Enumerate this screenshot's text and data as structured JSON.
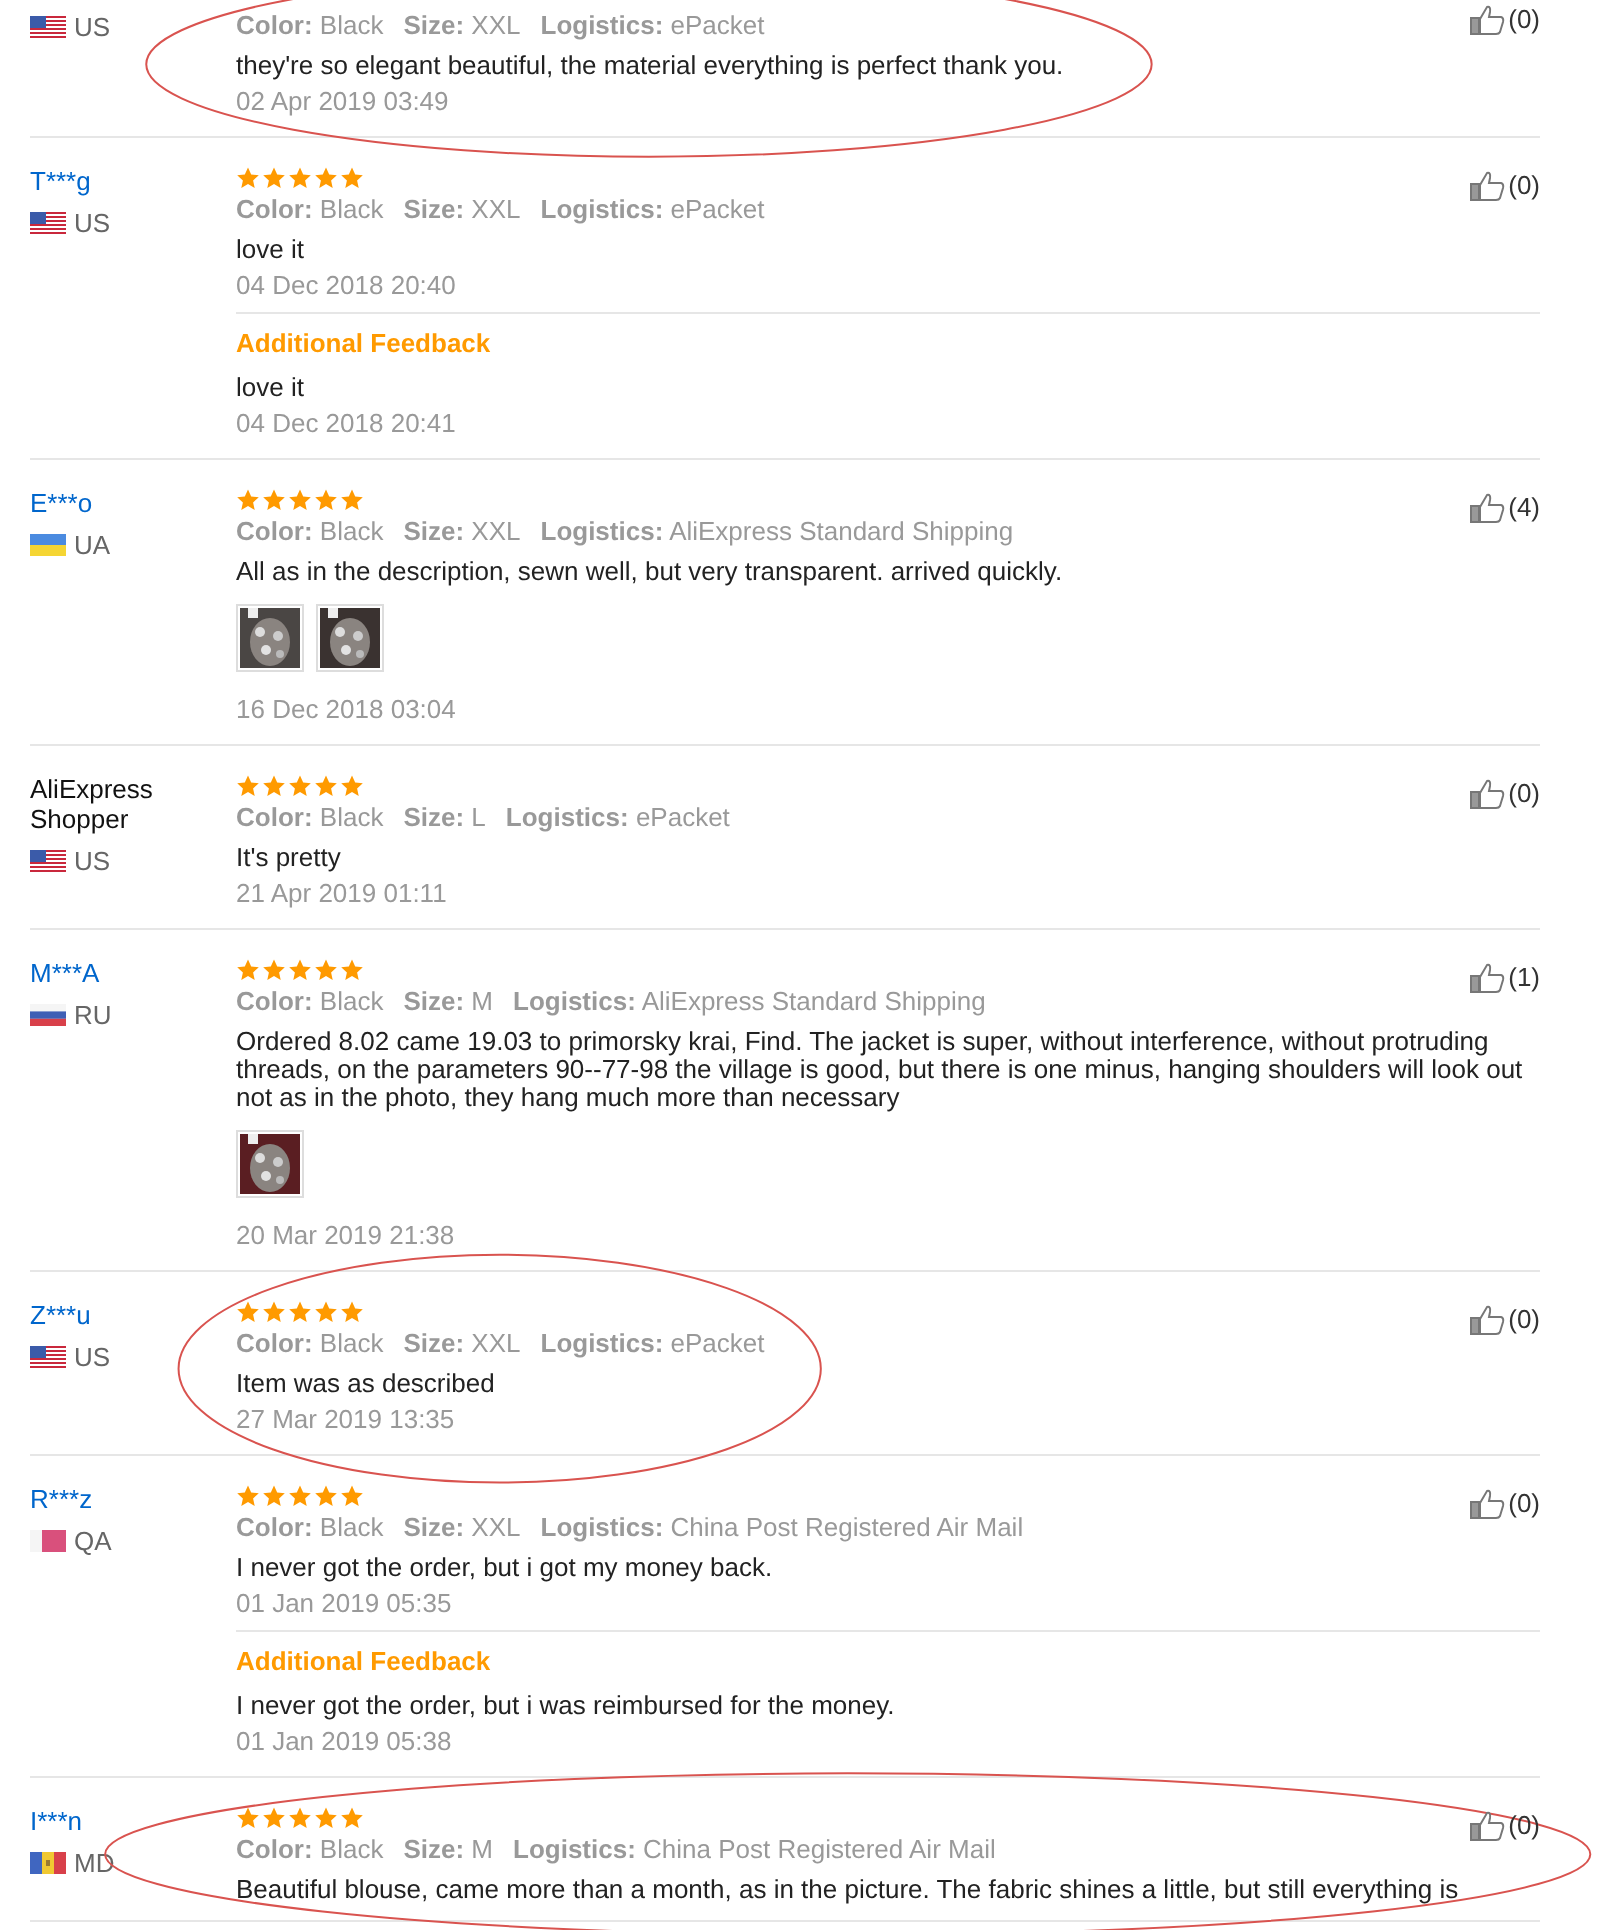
{
  "reviews": [
    {
      "country": {
        "code": "US",
        "kind": "us"
      },
      "attributes": [
        {
          "label": "Color:",
          "value": "Black"
        },
        {
          "label": "Size:",
          "value": "XXL"
        },
        {
          "label": "Logistics:",
          "value": "ePacket"
        }
      ],
      "text": "they're so elegant beautiful, the material everything is perfect thank you.",
      "date": "02 Apr 2019 03:49",
      "likes": "(0)",
      "circled": true
    },
    {
      "name": "T***g",
      "linked": true,
      "country": {
        "code": "US",
        "kind": "us"
      },
      "stars": 5,
      "attributes": [
        {
          "label": "Color:",
          "value": "Black"
        },
        {
          "label": "Size:",
          "value": "XXL"
        },
        {
          "label": "Logistics:",
          "value": "ePacket"
        }
      ],
      "text": "love it",
      "date": "04 Dec 2018 20:40",
      "likes": "(0)",
      "circled": false,
      "additional": {
        "title": "Additional Feedback",
        "text": "love it",
        "date": "04 Dec 2018 20:41"
      }
    },
    {
      "name": "E***o",
      "linked": true,
      "country": {
        "code": "UA",
        "kind": "ua"
      },
      "stars": 5,
      "attributes": [
        {
          "label": "Color:",
          "value": "Black"
        },
        {
          "label": "Size:",
          "value": "XXL"
        },
        {
          "label": "Logistics:",
          "value": "AliExpress Standard Shipping"
        }
      ],
      "text": "All as in the description, sewn well, but very transparent. arrived quickly.",
      "photos": [
        {
          "kind": "picture"
        },
        {
          "kind": "picture"
        }
      ],
      "date": "16 Dec 2018 03:04",
      "likes": "(4)",
      "circled": false
    },
    {
      "name": "AliExpress Shopper",
      "linked": false,
      "country": {
        "code": "US",
        "kind": "us"
      },
      "stars": 5,
      "attributes": [
        {
          "label": "Color:",
          "value": "Black"
        },
        {
          "label": "Size:",
          "value": "L"
        },
        {
          "label": "Logistics:",
          "value": "ePacket"
        }
      ],
      "text": "It's pretty",
      "date": "21 Apr 2019 01:11",
      "likes": "(0)",
      "circled": false
    },
    {
      "name": "M***A",
      "linked": true,
      "country": {
        "code": "RU",
        "kind": "ru"
      },
      "stars": 5,
      "attributes": [
        {
          "label": "Color:",
          "value": "Black"
        },
        {
          "label": "Size:",
          "value": "M"
        },
        {
          "label": "Logistics:",
          "value": "AliExpress Standard Shipping"
        }
      ],
      "text": "Ordered 8.02 came 19.03 to primorsky krai, Find. The jacket is super, without interference, without protruding threads, on the parameters 90--77-98 the village is good, but there is one minus, hanging shoulders will look out not as in the photo, they hang much more than necessary",
      "photos": [
        {
          "kind": "picture"
        }
      ],
      "date": "20 Mar 2019 21:38",
      "likes": "(1)",
      "circled": false
    },
    {
      "name": "Z***u",
      "linked": true,
      "country": {
        "code": "US",
        "kind": "us"
      },
      "stars": 5,
      "attributes": [
        {
          "label": "Color:",
          "value": "Black"
        },
        {
          "label": "Size:",
          "value": "XXL"
        },
        {
          "label": "Logistics:",
          "value": "ePacket"
        }
      ],
      "text": "Item was as described",
      "date": "27 Mar 2019 13:35",
      "likes": "(0)",
      "circled": true
    },
    {
      "name": "R***z",
      "linked": true,
      "country": {
        "code": "QA",
        "kind": "qa"
      },
      "stars": 5,
      "attributes": [
        {
          "label": "Color:",
          "value": "Black"
        },
        {
          "label": "Size:",
          "value": "XXL"
        },
        {
          "label": "Logistics:",
          "value": "China Post Registered Air Mail"
        }
      ],
      "text": "I never got the order, but i got my money back.",
      "date": "01 Jan 2019 05:35",
      "likes": "(0)",
      "circled": false,
      "additional": {
        "title": "Additional Feedback",
        "text": "I never got the order, but i was reimbursed for the money.",
        "date": "01 Jan 2019 05:38"
      }
    },
    {
      "name": "I***n",
      "linked": true,
      "country": {
        "code": "MD",
        "kind": "md"
      },
      "stars": 5,
      "attributes": [
        {
          "label": "Color:",
          "value": "Black"
        },
        {
          "label": "Size:",
          "value": "M"
        },
        {
          "label": "Logistics:",
          "value": "China Post Registered Air Mail"
        }
      ],
      "text": "Beautiful blouse, came more than a month, as in the picture. The fabric shines a little, but still everything is",
      "likes": "(0)",
      "circled": true
    }
  ]
}
